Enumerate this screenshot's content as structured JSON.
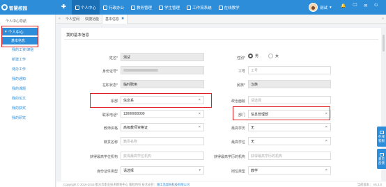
{
  "header": {
    "logo": "智慧校园",
    "menu_toggle": "✚",
    "nav": [
      {
        "label": "个人中心",
        "icon": "user-icon",
        "active": true
      },
      {
        "label": "行政办公",
        "icon": "office-icon",
        "active": false
      },
      {
        "label": "教务管理",
        "icon": "teaching-icon",
        "active": false
      },
      {
        "label": "学生管理",
        "icon": "student-icon",
        "active": false
      },
      {
        "label": "工作流系统",
        "icon": "workflow-icon",
        "active": false
      },
      {
        "label": "在线教学",
        "icon": "online-icon",
        "active": false
      }
    ],
    "user_name": "测试",
    "user_caret": "▾",
    "icons": {
      "bell": "🔔",
      "monitor": "🖵",
      "mail": "✉",
      "power": "⏻"
    }
  },
  "sidebar": {
    "title": "个人中心导航",
    "group": "个人中心",
    "group_caret": "▾",
    "items": [
      "基本信息",
      "我的工资/津贴",
      "新建工作",
      "待办工作",
      "我的通知",
      "我的课题",
      "我的论文",
      "我的获奖",
      "我的研究"
    ]
  },
  "tabs": {
    "left_arrow": "«",
    "items": [
      {
        "label": "个人空间",
        "closable": false
      },
      {
        "label": "快捷功能",
        "closable": false
      },
      {
        "label": "基本信息",
        "closable": true
      }
    ],
    "close_glyph": "✖",
    "right_arrow": "»"
  },
  "form": {
    "title": "我的基本信息",
    "clear_glyph": "×",
    "caret_glyph": "▾",
    "left": [
      {
        "label": "姓名*",
        "value": "测试",
        "style": "gray"
      },
      {
        "label": "身份证号*",
        "value": "",
        "style": "gray",
        "blurred": true
      },
      {
        "label": "在职状态*",
        "value": "临时聘用",
        "style": "gray"
      },
      {
        "label": "系部",
        "value": "信息系",
        "style": "white",
        "clear": true
      },
      {
        "label": "联系电话*",
        "value": "13000000000",
        "style": "white",
        "clear": true
      },
      {
        "label": "教师资格",
        "value": "高级教师资格证",
        "style": "white",
        "clear": true
      },
      {
        "label": "籍贯名称",
        "value": "籍贯名称",
        "style": "placeholder"
      },
      {
        "label": "获得最高学位机构",
        "value": "获得最高学位机构",
        "style": "placeholder"
      },
      {
        "label": "身份证件类型",
        "value": "请选择",
        "style": "white",
        "caret": true
      }
    ],
    "right": [
      {
        "label": "性别*",
        "type": "radio",
        "options": [
          "男",
          "女"
        ],
        "selected": 0
      },
      {
        "label": "工号",
        "value": "工号",
        "style": "placeholder"
      },
      {
        "label": "民族*",
        "value": "汉族",
        "style": "gray"
      },
      {
        "label": "政治面貌",
        "value": "请选择",
        "style": "placeholder"
      },
      {
        "label": "部门",
        "value": "信息管理部",
        "style": "white",
        "clear": true
      },
      {
        "label": "最高学历",
        "value": "无",
        "style": "white",
        "clear": true
      },
      {
        "label": "最高学位",
        "value": "无",
        "style": "white",
        "clear": true
      },
      {
        "label": "获得最高学历的机构",
        "value": "获得最高学历的机构",
        "style": "placeholder"
      },
      {
        "label": "岗位类型",
        "value": "教学",
        "style": "white",
        "clear": true
      }
    ]
  },
  "footer": {
    "copyright": "Copyright © 2015-2018  衡水市职业技术教育中心 版权所有  技术支持：",
    "support": "施工监督局科技有限公司",
    "version": "当前版本： V5.3.0"
  },
  "floating": [
    {
      "label": "在线客服",
      "icon": "chat-icon"
    },
    {
      "label": "意见反馈",
      "icon": "feedback-icon"
    }
  ],
  "colors": {
    "primary": "#2e8dd9",
    "highlight": "#e02020",
    "nav_active": "#1a6fb5"
  }
}
